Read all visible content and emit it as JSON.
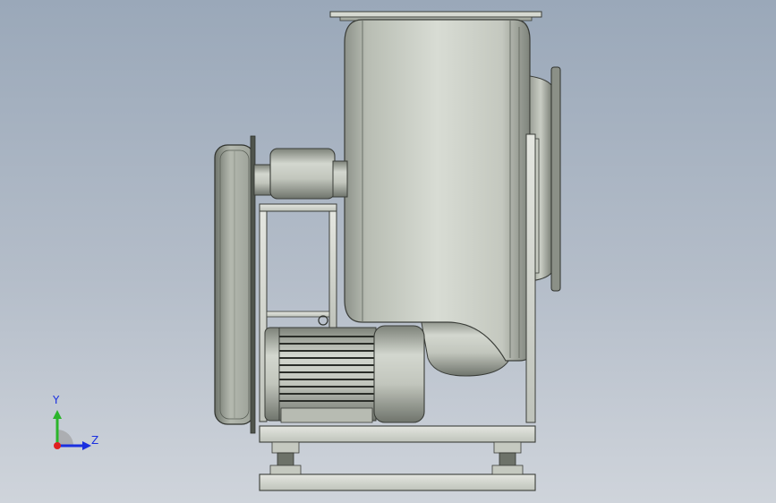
{
  "viewport": {
    "background_top": "#9aa8b9",
    "background_bottom": "#cfd4db"
  },
  "model": {
    "parts": [
      "fan-housing",
      "outlet-flange",
      "inlet-flange",
      "belt-guard",
      "bearing-housing",
      "support-frame",
      "electric-motor",
      "base-frame",
      "vibration-isolators"
    ]
  },
  "triad": {
    "y_label": "Y",
    "z_label": "Z",
    "y_color": "#2bb52b",
    "z_color": "#1a2fe0",
    "x_color": "#e02020"
  }
}
